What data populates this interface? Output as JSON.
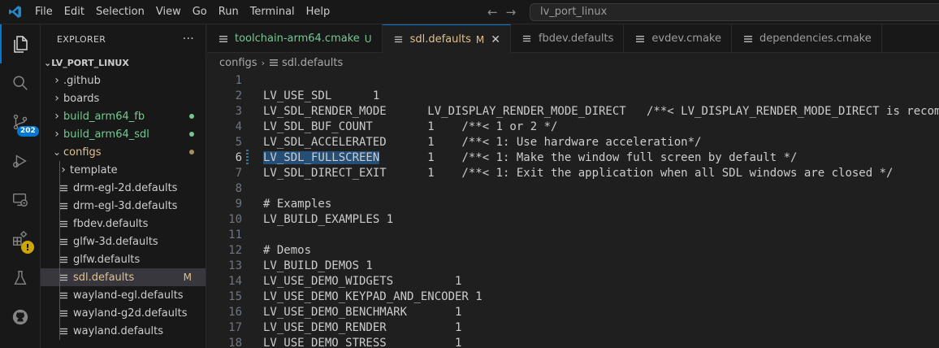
{
  "menu": [
    "File",
    "Edit",
    "Selection",
    "View",
    "Go",
    "Run",
    "Terminal",
    "Help"
  ],
  "command_center": {
    "text": "lv_port_linux"
  },
  "activity": {
    "source_control_badge": "202",
    "warning_badge": "!"
  },
  "explorer": {
    "title": "EXPLORER",
    "more": "···",
    "root": "LV_PORT_LINUX",
    "items": [
      {
        "label": ".github",
        "type": "folder",
        "expanded": false,
        "depth": 0,
        "color": "#cccccc"
      },
      {
        "label": "boards",
        "type": "folder",
        "expanded": false,
        "depth": 0,
        "color": "#cccccc"
      },
      {
        "label": "build_arm64_fb",
        "type": "folder",
        "expanded": false,
        "depth": 0,
        "color": "#73c991",
        "dot": "#73c991"
      },
      {
        "label": "build_arm64_sdl",
        "type": "folder",
        "expanded": false,
        "depth": 0,
        "color": "#73c991",
        "dot": "#73c991"
      },
      {
        "label": "configs",
        "type": "folder",
        "expanded": true,
        "depth": 0,
        "color": "#e2c08d",
        "dot": "#a88f5f"
      },
      {
        "label": "template",
        "type": "folder",
        "expanded": false,
        "depth": 1,
        "color": "#cccccc"
      },
      {
        "label": "drm-egl-2d.defaults",
        "type": "file",
        "depth": 1,
        "color": "#cccccc"
      },
      {
        "label": "drm-egl-3d.defaults",
        "type": "file",
        "depth": 1,
        "color": "#cccccc"
      },
      {
        "label": "fbdev.defaults",
        "type": "file",
        "depth": 1,
        "color": "#cccccc"
      },
      {
        "label": "glfw-3d.defaults",
        "type": "file",
        "depth": 1,
        "color": "#cccccc"
      },
      {
        "label": "glfw.defaults",
        "type": "file",
        "depth": 1,
        "color": "#cccccc"
      },
      {
        "label": "sdl.defaults",
        "type": "file",
        "depth": 1,
        "color": "#e2c08d",
        "mark": "M",
        "selected": true
      },
      {
        "label": "wayland-egl.defaults",
        "type": "file",
        "depth": 1,
        "color": "#cccccc"
      },
      {
        "label": "wayland-g2d.defaults",
        "type": "file",
        "depth": 1,
        "color": "#cccccc"
      },
      {
        "label": "wayland.defaults",
        "type": "file",
        "depth": 1,
        "color": "#cccccc"
      }
    ]
  },
  "tabs": [
    {
      "label": "toolchain-arm64.cmake",
      "mark": "U",
      "color": "#73c991",
      "active": false
    },
    {
      "label": "sdl.defaults",
      "mark": "M",
      "color": "#e2c08d",
      "active": true,
      "close": "✕"
    },
    {
      "label": "fbdev.defaults",
      "active": false,
      "color": "#9d9d9d"
    },
    {
      "label": "evdev.cmake",
      "active": false,
      "color": "#9d9d9d"
    },
    {
      "label": "dependencies.cmake",
      "active": false,
      "color": "#9d9d9d"
    }
  ],
  "breadcrumbs": {
    "folder": "configs",
    "file": "sdl.defaults"
  },
  "editor": {
    "current_line": 6,
    "lines": [
      "",
      "LV_USE_SDL      1",
      "LV_SDL_RENDER_MODE      LV_DISPLAY_RENDER_MODE_DIRECT   /**< LV_DISPLAY_RENDER_MODE_DIRECT is recom",
      "LV_SDL_BUF_COUNT        1    /**< 1 or 2 */",
      "LV_SDL_ACCELERATED      1    /**< 1: Use hardware acceleration*/",
      "LV_SDL_FULLSCREEN       1    /**< 1: Make the window full screen by default */",
      "LV_SDL_DIRECT_EXIT      1    /**< 1: Exit the application when all SDL windows are closed */",
      "",
      "# Examples",
      "LV_BUILD_EXAMPLES 1",
      "",
      "# Demos",
      "LV_BUILD_DEMOS 1",
      "LV_USE_DEMO_WIDGETS         1",
      "LV_USE_DEMO_KEYPAD_AND_ENCODER 1",
      "LV_USE_DEMO_BENCHMARK       1",
      "LV_USE_DEMO_RENDER          1",
      "LV_USE_DEMO_STRESS          1"
    ],
    "highlight_word": "LV_SDL_FULLSCREEN"
  },
  "colors": {
    "accent": "#0078d4",
    "modified": "#e2c08d",
    "untracked": "#73c991"
  }
}
